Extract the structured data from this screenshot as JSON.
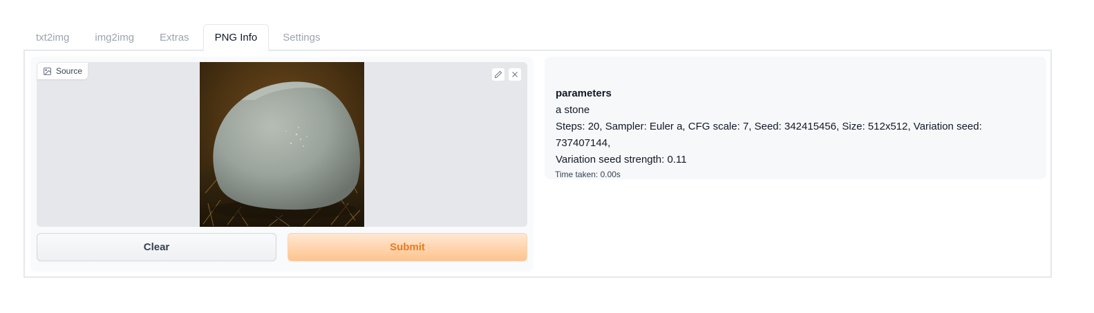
{
  "tabs": [
    {
      "label": "txt2img",
      "active": false
    },
    {
      "label": "img2img",
      "active": false
    },
    {
      "label": "Extras",
      "active": false
    },
    {
      "label": "PNG Info",
      "active": true
    },
    {
      "label": "Settings",
      "active": false
    }
  ],
  "source": {
    "label": "Source",
    "icon": "image-icon",
    "tools": [
      "edit-icon",
      "close-icon"
    ]
  },
  "buttons": {
    "clear_label": "Clear",
    "submit_label": "Submit"
  },
  "info": {
    "heading": "parameters",
    "prompt": "a stone",
    "settings_line1": "Steps: 20, Sampler: Euler a, CFG scale: 7, Seed: 342415456, Size: 512x512, Variation seed: 737407144,",
    "settings_line2": "Variation seed strength: 0.11",
    "time_taken": "Time taken: 0.00s"
  },
  "colors": {
    "accent": "#ea7a1c",
    "submit_bg": "#fec38f",
    "panel_border": "#e5e7eb"
  }
}
